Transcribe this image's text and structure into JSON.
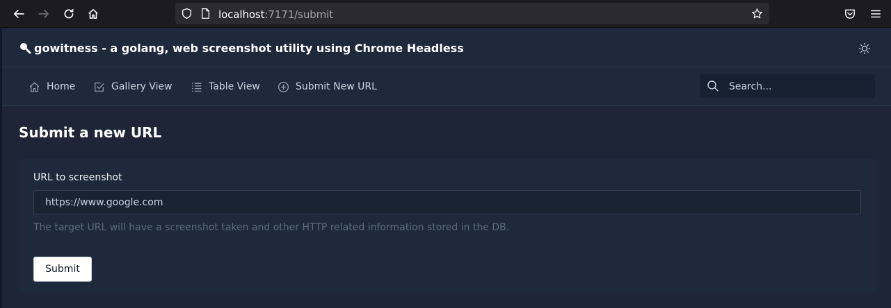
{
  "browser": {
    "url_host": "localhost",
    "url_path": ":7171/submit"
  },
  "header": {
    "title": "gowitness - a golang, web screenshot utility using Chrome Headless"
  },
  "nav": {
    "items": [
      {
        "label": "Home",
        "icon": "home-icon"
      },
      {
        "label": "Gallery View",
        "icon": "check-square-icon"
      },
      {
        "label": "Table View",
        "icon": "list-icon"
      },
      {
        "label": "Submit New URL",
        "icon": "plus-circle-icon"
      }
    ],
    "search_placeholder": "Search..."
  },
  "main": {
    "heading": "Submit a new URL",
    "field_label": "URL to screenshot",
    "url_placeholder": "https://www.google.com",
    "helper_text": "The target URL will have a screenshot taken and other HTTP related information stored in the DB.",
    "submit_label": "Submit"
  },
  "colors": {
    "page_bg": "#1e2536",
    "header_bg": "#1e293b",
    "browser_bg": "#1c1b22"
  }
}
